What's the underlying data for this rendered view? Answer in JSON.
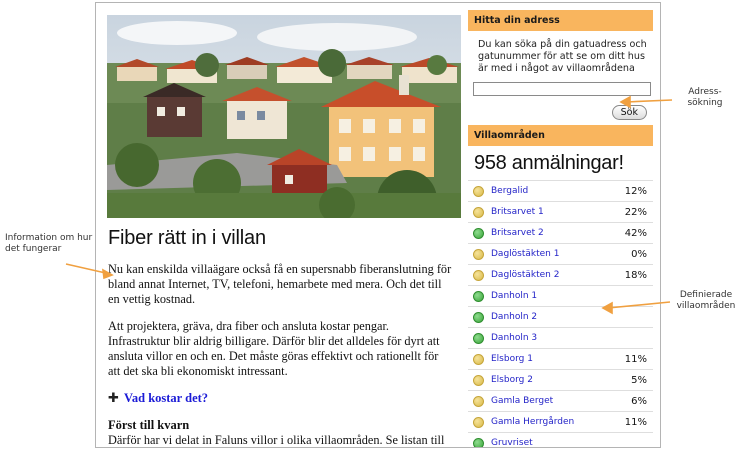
{
  "annotations": {
    "info": "Information om hur det fungerar",
    "address_search": "Adress-\nsökning",
    "villa_areas": "Definierade villaområden"
  },
  "article": {
    "title": "Fiber rätt in i villan",
    "paragraph1": "Nu kan enskilda villaägare också få en supersnabb fiberanslutning för bland annat Internet, TV, telefoni, hemarbete med mera. Och det till en vettig kostnad.",
    "paragraph2": "Att projektera, gräva, dra fiber och ansluta kostar pengar. Infrastruktur blir aldrig billigare. Därför blir det alldeles för dyrt att ansluta villor en och en. Det måste göras effektivt och rationellt för att det ska bli ekonomiskt intressant.",
    "cost_link": "Vad kostar det?",
    "first_heading": "Först till kvarn",
    "paragraph3": "Därför har vi delat in Faluns villor i olika villaområden. Se listan till"
  },
  "search": {
    "header": "Hitta din adress",
    "description": "Du kan söka på din gatuadress och gatunummer för att se om ditt hus är med i något av villaområdena",
    "input_value": "",
    "button": "Sök"
  },
  "villa": {
    "header": "Villaområden",
    "count": "958 anmälningar!",
    "areas": [
      {
        "name": "Bergalid",
        "status": "yellow",
        "percent": "12%"
      },
      {
        "name": "Britsarvet 1",
        "status": "yellow",
        "percent": "22%"
      },
      {
        "name": "Britsarvet 2",
        "status": "green",
        "percent": "42%"
      },
      {
        "name": "Daglöstäkten 1",
        "status": "yellow",
        "percent": "0%"
      },
      {
        "name": "Daglöstäkten 2",
        "status": "yellow",
        "percent": "18%"
      },
      {
        "name": "Danholn 1",
        "status": "green",
        "percent": ""
      },
      {
        "name": "Danholn 2",
        "status": "green",
        "percent": ""
      },
      {
        "name": "Danholn 3",
        "status": "green",
        "percent": ""
      },
      {
        "name": "Elsborg 1",
        "status": "yellow",
        "percent": "11%"
      },
      {
        "name": "Elsborg 2",
        "status": "yellow",
        "percent": "5%"
      },
      {
        "name": "Gamla Berget",
        "status": "yellow",
        "percent": "6%"
      },
      {
        "name": "Gamla Herrgården",
        "status": "yellow",
        "percent": "11%"
      },
      {
        "name": "Gruvriset",
        "status": "green",
        "percent": ""
      }
    ]
  },
  "colors": {
    "sidebar_header": "#f9b55e",
    "link": "#1b1bd6",
    "annotation_arrow": "#f0a040",
    "status_green": "#3aa53a",
    "status_yellow": "#d8b948"
  }
}
